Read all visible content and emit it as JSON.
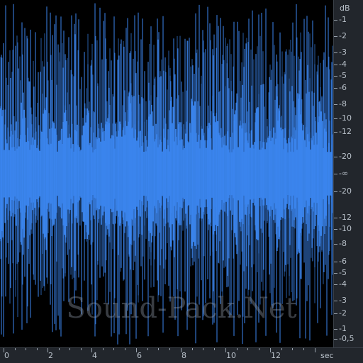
{
  "colors": {
    "waveform": "#3b86ef",
    "background": "#000000",
    "ruler_bg": "#22262c",
    "ruler_text": "#b9c1ca"
  },
  "db_scale": {
    "unit": "dB",
    "labels_top": [
      "-1",
      "-2",
      "-3",
      "-4",
      "-5",
      "-6",
      "-8",
      "-10",
      "-12",
      "-20"
    ],
    "center_label": "-∞",
    "labels_bottom": [
      "-20",
      "-12",
      "-10",
      "-8",
      "-6",
      "-5",
      "-4",
      "-3",
      "-2",
      "-1",
      "-0,5"
    ]
  },
  "time_scale": {
    "unit": "sec",
    "labels": [
      "0",
      "2",
      "4",
      "6",
      "8",
      "10",
      "12"
    ]
  },
  "watermark": "Sound-Pack.Net"
}
